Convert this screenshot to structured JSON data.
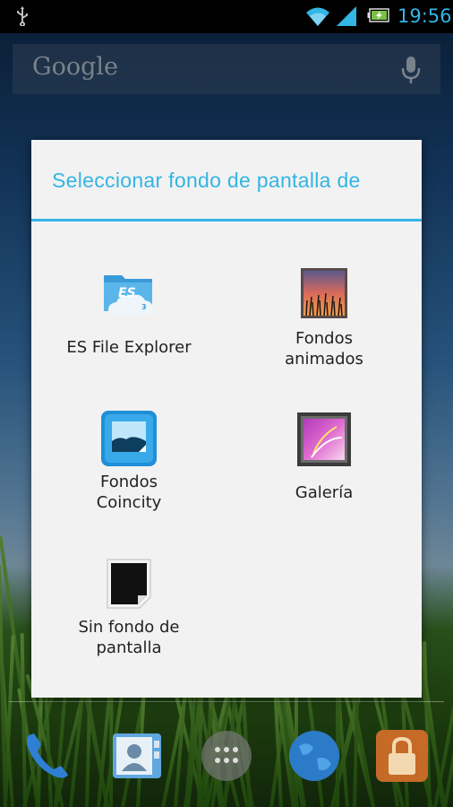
{
  "status_bar": {
    "time": "19:56",
    "icons": [
      "usb-icon",
      "wifi-icon",
      "signal-icon",
      "battery-charging-icon"
    ],
    "accent_color": "#33b5e5"
  },
  "search_bar": {
    "label": "Google",
    "mic_icon": "mic-icon"
  },
  "dialog": {
    "title": "Seleccionar fondo de pantalla de",
    "accent_color": "#33b5e5",
    "options": [
      {
        "label_1": "ES File Explorer",
        "label_2": "",
        "icon": "es-file-explorer-icon"
      },
      {
        "label_1": "Fondos",
        "label_2": "animados",
        "icon": "live-wallpapers-icon"
      },
      {
        "label_1": "Fondos",
        "label_2": "Coincity",
        "icon": "coincity-wallpapers-icon"
      },
      {
        "label_1": "Galería",
        "label_2": "",
        "icon": "gallery-icon"
      },
      {
        "label_1": "Sin fondo de",
        "label_2": "pantalla",
        "icon": "no-wallpaper-icon"
      }
    ]
  },
  "dock": {
    "apps": [
      "phone-icon",
      "contacts-icon",
      "app-drawer-icon",
      "browser-icon",
      "lock-app-icon"
    ]
  }
}
